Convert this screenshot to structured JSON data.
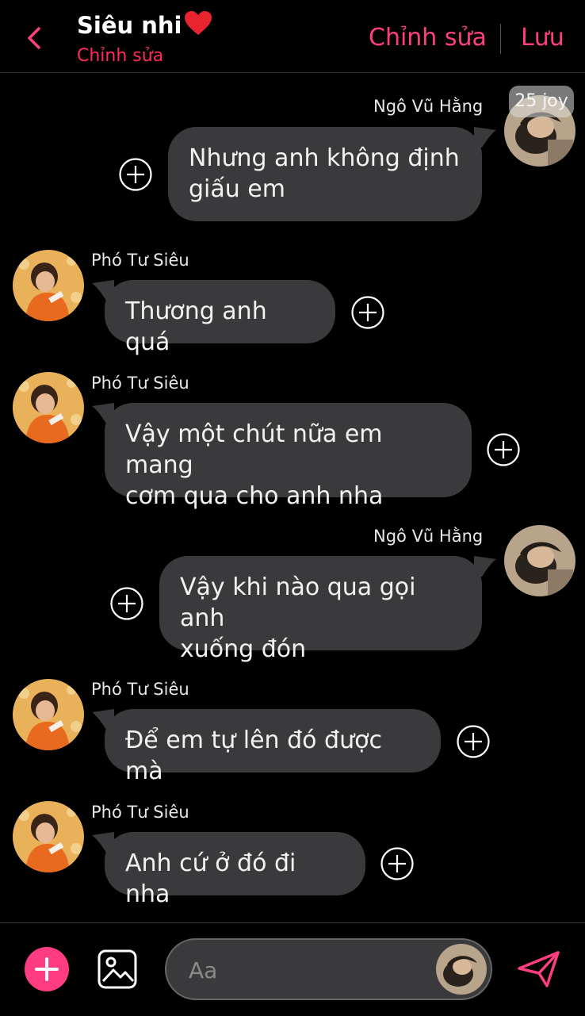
{
  "header": {
    "title": "Siêu nhi",
    "subtitle": "Chỉnh sửa",
    "edit_label": "Chỉnh sửa",
    "save_label": "Lưu",
    "accent_color": "#ff3e7f"
  },
  "messages": [
    {
      "sender": "Ngô Vũ Hằng",
      "side": "right",
      "text_lines": [
        "Nhưng anh không định",
        "giấu em"
      ]
    },
    {
      "sender": "Phó Tư Siêu",
      "side": "left",
      "text_lines": [
        "Thương anh quá"
      ]
    },
    {
      "sender": "Phó Tư Siêu",
      "side": "left",
      "text_lines": [
        "Vậy một chút nữa em mang",
        "cơm qua cho anh nha"
      ]
    },
    {
      "sender": "Ngô Vũ Hằng",
      "side": "right",
      "text_lines": [
        "Vậy khi nào qua gọi anh",
        "xuống đón"
      ]
    },
    {
      "sender": "Phó Tư Siêu",
      "side": "left",
      "text_lines": [
        "Để em tự lên đó được mà"
      ]
    },
    {
      "sender": "Phó Tư Siêu",
      "side": "left",
      "text_lines": [
        "Anh cứ ở đó đi nha"
      ]
    }
  ],
  "watermark": "25 joy",
  "composer": {
    "placeholder": "Aa"
  },
  "icons": {
    "back": "chevron-left-icon",
    "add": "plus-icon",
    "image": "image-icon",
    "send": "send-icon",
    "react": "plus-circle-icon"
  }
}
